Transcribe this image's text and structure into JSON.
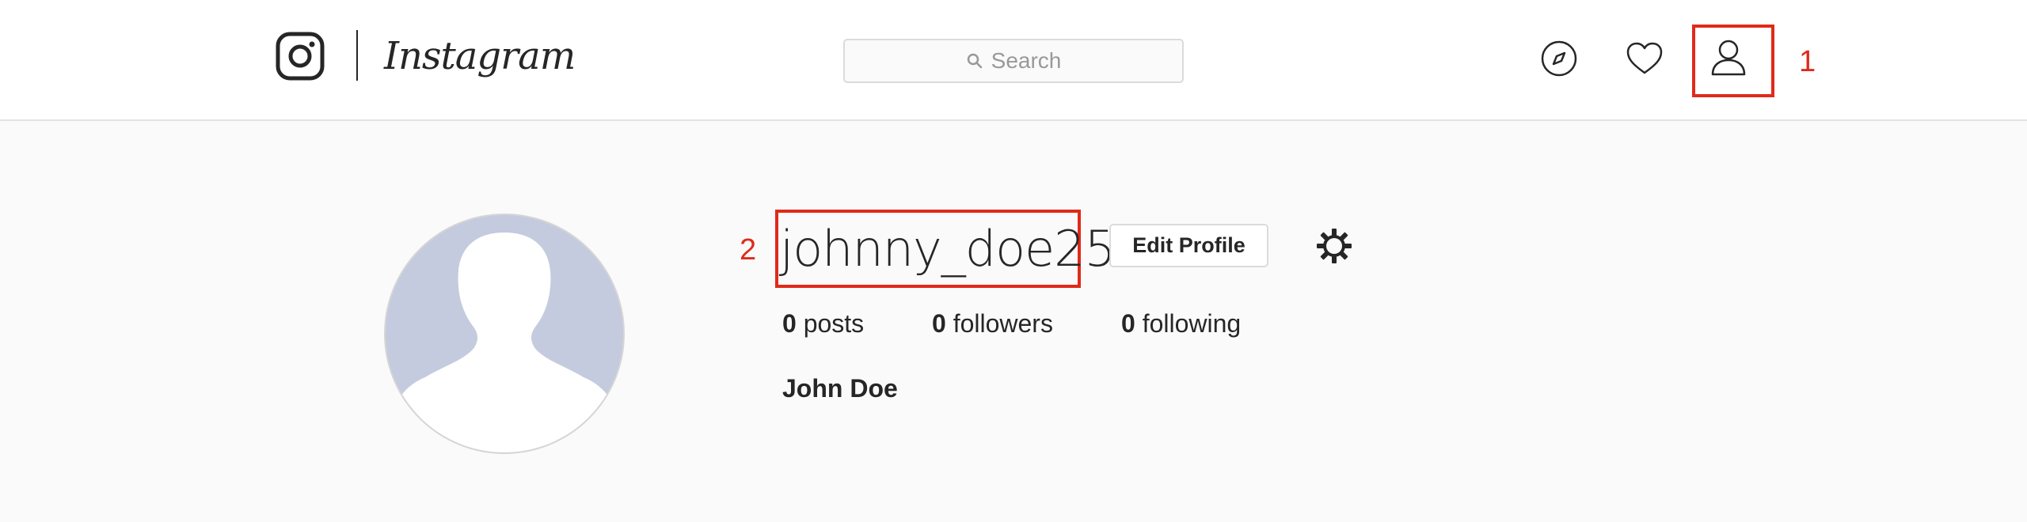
{
  "app": {
    "wordmark": "Instagram"
  },
  "header": {
    "search": {
      "placeholder": "Search"
    },
    "icons": [
      "camera-logo-icon",
      "explore-compass-icon",
      "activity-heart-icon",
      "profile-person-icon"
    ]
  },
  "profile": {
    "username": "johnny_doe25",
    "edit_label": "Edit Profile",
    "settings_icon": "gear-icon",
    "stats": {
      "posts_count": "0",
      "posts_label": "posts",
      "followers_count": "0",
      "followers_label": "followers",
      "following_count": "0",
      "following_label": "following"
    },
    "full_name": "John Doe"
  },
  "annotations": {
    "marker_1": "1",
    "marker_2": "2",
    "color": "#e02a1a"
  }
}
